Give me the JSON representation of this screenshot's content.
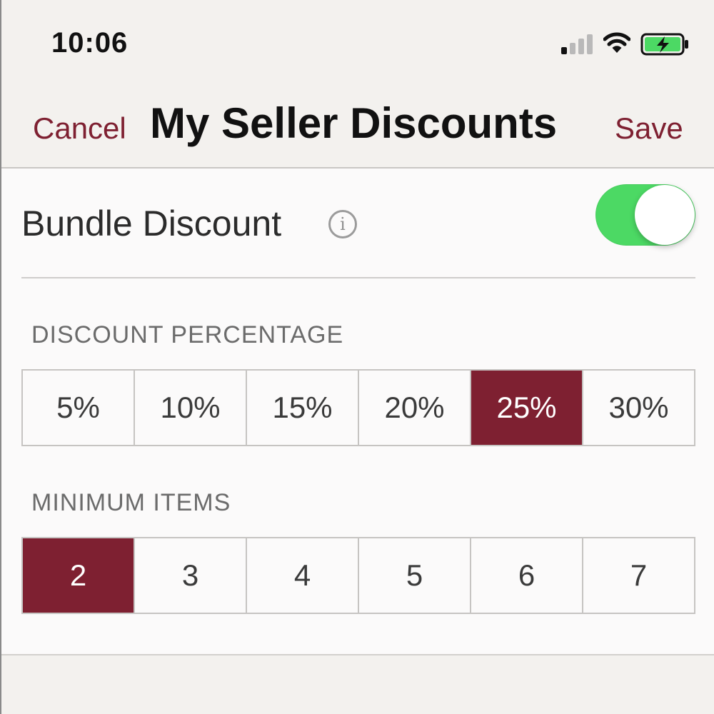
{
  "status_bar": {
    "time": "10:06",
    "icons": [
      "signal-icon",
      "wifi-icon",
      "battery-charging-icon"
    ]
  },
  "nav": {
    "cancel_label": "Cancel",
    "title": "My Seller Discounts",
    "save_label": "Save"
  },
  "bundle": {
    "label": "Bundle Discount",
    "info_glyph": "i",
    "enabled": true
  },
  "discount_percentage": {
    "label": "DISCOUNT PERCENTAGE",
    "options": [
      "5%",
      "10%",
      "15%",
      "20%",
      "25%",
      "30%"
    ],
    "selected": "25%"
  },
  "minimum_items": {
    "label": "MINIMUM ITEMS",
    "options": [
      "2",
      "3",
      "4",
      "5",
      "6",
      "7"
    ],
    "selected": "2"
  },
  "colors": {
    "accent": "#7e2031",
    "toggle_on": "#4cd964",
    "battery_green": "#4cd964"
  }
}
